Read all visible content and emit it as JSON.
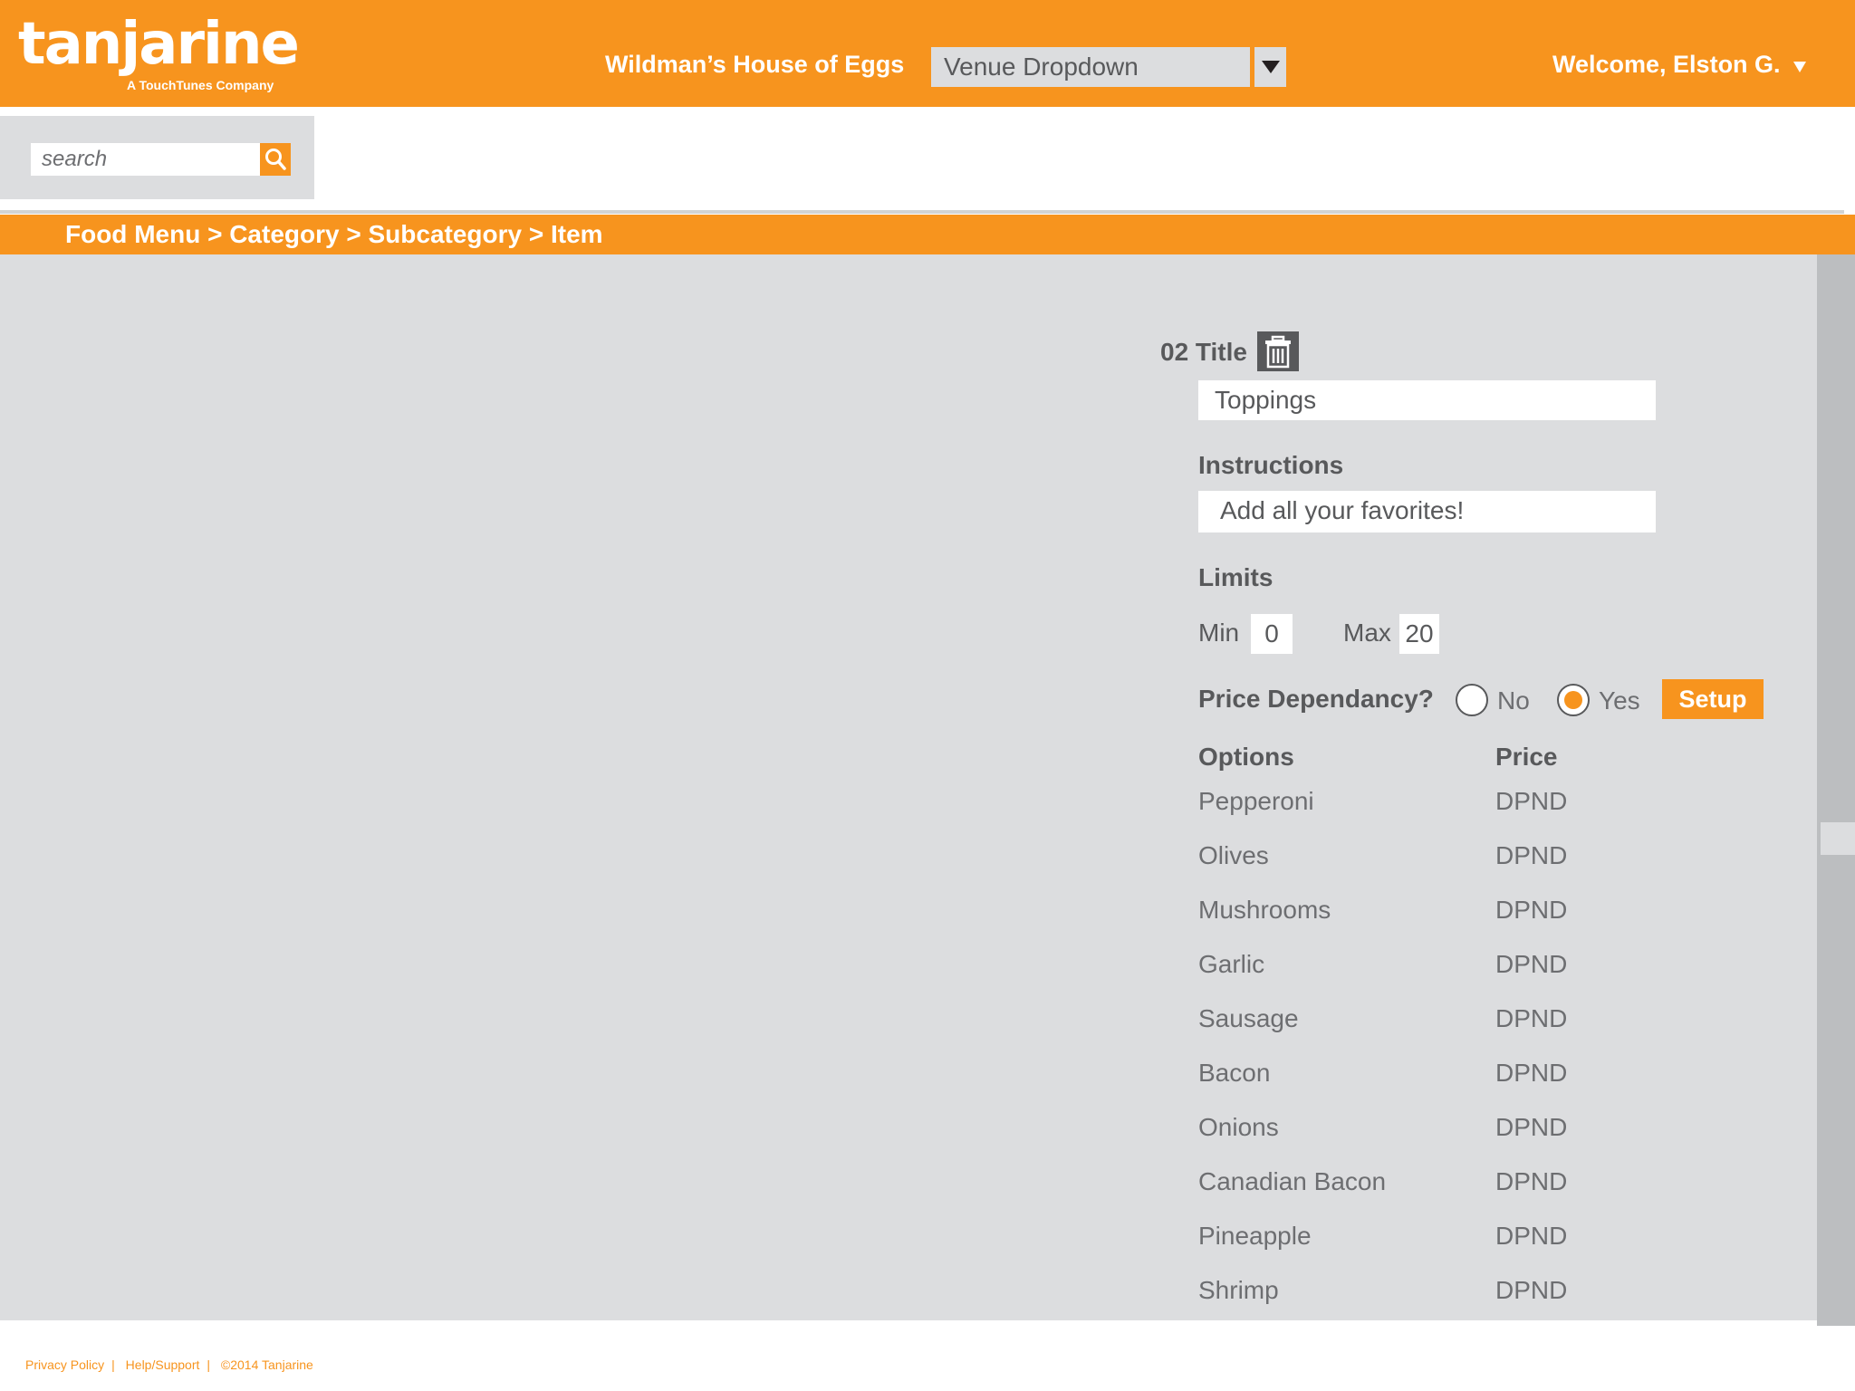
{
  "brand": {
    "name": "tanjarine",
    "tagline": "A TouchTunes Company",
    "trademark": "™",
    "accent": "#f7941e"
  },
  "header": {
    "venue_name": "Wildman’s House of Eggs",
    "venue_dropdown": "Venue Dropdown",
    "welcome": "Welcome, Elston G."
  },
  "search": {
    "placeholder": "search"
  },
  "breadcrumb": "Food Menu > Category > Subcategory > Item",
  "form": {
    "title_label": "02 Title",
    "title_value": "Toppings",
    "instructions_label": "Instructions",
    "instructions_value": "Add all your favorites!",
    "limits_label": "Limits",
    "min_label": "Min",
    "min_value": "0",
    "max_label": "Max",
    "max_value": "20",
    "price_dep_label": "Price Dependancy?",
    "no_label": "No",
    "yes_label": "Yes",
    "price_dep_selected": "Yes",
    "setup_label": "Setup",
    "options_header": "Options",
    "price_header": "Price",
    "options": [
      {
        "name": "Pepperoni",
        "price": "DPND"
      },
      {
        "name": "Olives",
        "price": "DPND"
      },
      {
        "name": "Mushrooms",
        "price": "DPND"
      },
      {
        "name": "Garlic",
        "price": "DPND"
      },
      {
        "name": "Sausage",
        "price": "DPND"
      },
      {
        "name": "Bacon",
        "price": "DPND"
      },
      {
        "name": "Onions",
        "price": "DPND"
      },
      {
        "name": "Canadian Bacon",
        "price": "DPND"
      },
      {
        "name": "Pineapple",
        "price": "DPND"
      },
      {
        "name": "Shrimp",
        "price": "DPND"
      }
    ]
  },
  "footer": {
    "privacy": "Privacy Policy",
    "help": "Help/Support",
    "copyright": "©2014 Tanjarine"
  }
}
